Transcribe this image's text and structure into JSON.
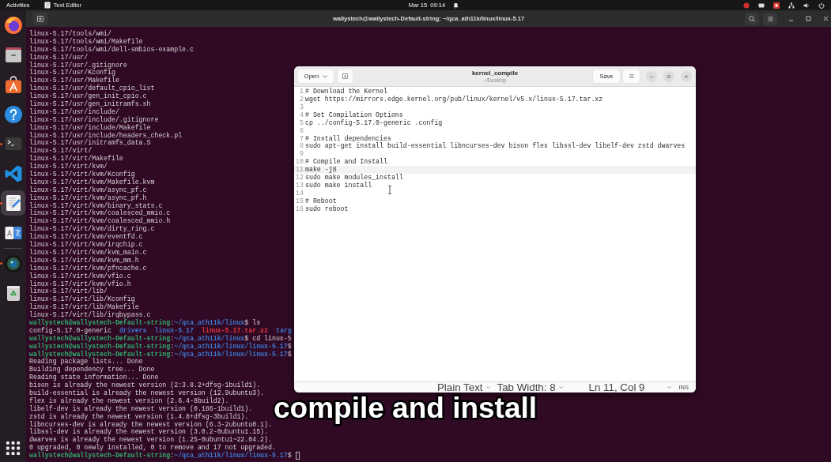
{
  "top_bar": {
    "activities": "Activities",
    "app_menu": "Text Editor",
    "clock": "Mar 15  09:14"
  },
  "dock": {
    "favorites": [
      {
        "kind": "browser",
        "running": false,
        "selected": false
      },
      {
        "kind": "files",
        "running": false,
        "selected": false
      },
      {
        "kind": "store",
        "running": false,
        "selected": false
      },
      {
        "kind": "help",
        "running": false,
        "selected": false
      },
      {
        "kind": "terminal",
        "running": true,
        "selected": false
      },
      {
        "kind": "code",
        "running": false,
        "selected": false
      },
      {
        "kind": "text_editor",
        "running": true,
        "selected": true
      },
      {
        "kind": "translator",
        "running": false,
        "selected": false
      }
    ],
    "others": [
      {
        "kind": "webcam",
        "running": true,
        "selected": false
      },
      {
        "kind": "trash",
        "running": false,
        "selected": false
      }
    ]
  },
  "terminal": {
    "title": "wallystech@wallystech-Default-string: ~/qca_ath11k/linux/linux-5.17",
    "cursor": true,
    "lines": [
      {
        "text": "linux-5.17/tools/wmi/"
      },
      {
        "text": "linux-5.17/tools/wmi/Makefile"
      },
      {
        "text": "linux-5.17/tools/wmi/dell-smbios-example.c"
      },
      {
        "text": "linux-5.17/usr/"
      },
      {
        "text": "linux-5.17/usr/.gitignore"
      },
      {
        "text": "linux-5.17/usr/Kconfig"
      },
      {
        "text": "linux-5.17/usr/Makefile"
      },
      {
        "text": "linux-5.17/usr/default_cpio_list"
      },
      {
        "text": "linux-5.17/usr/gen_init_cpio.c"
      },
      {
        "text": "linux-5.17/usr/gen_initramfs.sh"
      },
      {
        "text": "linux-5.17/usr/include/"
      },
      {
        "text": "linux-5.17/usr/include/.gitignore"
      },
      {
        "text": "linux-5.17/usr/include/Makefile"
      },
      {
        "text": "linux-5.17/usr/include/headers_check.pl"
      },
      {
        "text": "linux-5.17/usr/initramfs_data.S"
      },
      {
        "text": "linux-5.17/virt/"
      },
      {
        "text": "linux-5.17/virt/Makefile"
      },
      {
        "text": "linux-5.17/virt/kvm/"
      },
      {
        "text": "linux-5.17/virt/kvm/Kconfig"
      },
      {
        "text": "linux-5.17/virt/kvm/Makefile.kvm"
      },
      {
        "text": "linux-5.17/virt/kvm/async_pf.c"
      },
      {
        "text": "linux-5.17/virt/kvm/async_pf.h"
      },
      {
        "text": "linux-5.17/virt/kvm/binary_stats.c"
      },
      {
        "text": "linux-5.17/virt/kvm/coalesced_mmio.c"
      },
      {
        "text": "linux-5.17/virt/kvm/coalesced_mmio.h"
      },
      {
        "text": "linux-5.17/virt/kvm/dirty_ring.c"
      },
      {
        "text": "linux-5.17/virt/kvm/eventfd.c"
      },
      {
        "text": "linux-5.17/virt/kvm/irqchip.c"
      },
      {
        "text": "linux-5.17/virt/kvm/kvm_main.c"
      },
      {
        "text": "linux-5.17/virt/kvm/kvm_mm.h"
      },
      {
        "text": "linux-5.17/virt/kvm/pfncache.c"
      },
      {
        "text": "linux-5.17/virt/kvm/vfio.c"
      },
      {
        "text": "linux-5.17/virt/kvm/vfio.h"
      },
      {
        "text": "linux-5.17/virt/lib/"
      },
      {
        "text": "linux-5.17/virt/lib/Kconfig"
      },
      {
        "text": "linux-5.17/virt/lib/Makefile"
      },
      {
        "text": "linux-5.17/virt/lib/irqbypass.c"
      },
      {
        "segments": [
          {
            "kind": "user",
            "text": "wallystech@wallystech-Default-string"
          },
          {
            "kind": "plain",
            "text": ":"
          },
          {
            "kind": "path",
            "text": "~/qca_ath11k/linux"
          },
          {
            "kind": "plain",
            "text": "$ ls"
          }
        ]
      },
      {
        "segments": [
          {
            "kind": "plain",
            "text": "config-5.17.0-generic  "
          },
          {
            "kind": "directory",
            "text": "drivers  "
          },
          {
            "kind": "directory",
            "text": "linux-5.17  "
          },
          {
            "kind": "archive",
            "text": "linux-5.17.tar.xz  "
          },
          {
            "kind": "directory",
            "text": "targ"
          }
        ]
      },
      {
        "segments": [
          {
            "kind": "user",
            "text": "wallystech@wallystech-Default-string"
          },
          {
            "kind": "plain",
            "text": ":"
          },
          {
            "kind": "path",
            "text": "~/qca_ath11k/linux"
          },
          {
            "kind": "plain",
            "text": "$ cd linux-5"
          }
        ]
      },
      {
        "segments": [
          {
            "kind": "user",
            "text": "wallystech@wallystech-Default-string"
          },
          {
            "kind": "plain",
            "text": ":"
          },
          {
            "kind": "path",
            "text": "~/qca_ath11k/linux/linux-5.17"
          },
          {
            "kind": "plain",
            "text": "$"
          }
        ]
      },
      {
        "segments": [
          {
            "kind": "user",
            "text": "wallystech@wallystech-Default-string"
          },
          {
            "kind": "plain",
            "text": ":"
          },
          {
            "kind": "path",
            "text": "~/qca_ath11k/linux/linux-5.17"
          },
          {
            "kind": "plain",
            "text": "$"
          }
        ]
      },
      {
        "text": "Reading package lists... Done"
      },
      {
        "text": "Building dependency tree... Done"
      },
      {
        "text": "Reading state information... Done"
      },
      {
        "text": "bison is already the newest version (2:3.8.2+dfsg-1build1)."
      },
      {
        "text": "build-essential is already the newest version (12.9ubuntu3)."
      },
      {
        "text": "flex is already the newest version (2.6.4-8build2)."
      },
      {
        "text": "libelf-dev is already the newest version (0.186-1build1)."
      },
      {
        "text": "zstd is already the newest version (1.4.8+dfsg-3build1)."
      },
      {
        "text": "libncurses-dev is already the newest version (6.3-2ubuntu0.1)."
      },
      {
        "text": "libssl-dev is already the newest version (3.0.2-0ubuntu1.15)."
      },
      {
        "text": "dwarves is already the newest version (1.25-0ubuntu1~22.04.2)."
      },
      {
        "text": "0 upgraded, 0 newly installed, 0 to remove and 17 not upgraded."
      },
      {
        "segments": [
          {
            "kind": "user",
            "text": "wallystech@wallystech-Default-string"
          },
          {
            "kind": "plain",
            "text": ":"
          },
          {
            "kind": "path",
            "text": "~/qca_ath11k/linux/linux-5.17"
          },
          {
            "kind": "plain",
            "text": "$"
          }
        ]
      }
    ]
  },
  "editor": {
    "title": "kernel_compile",
    "subtitle": "~/Desktop",
    "open_button": "Open",
    "save_button": "Save",
    "lines": [
      {
        "number": "1",
        "text": "# Download the Kernel",
        "current": false
      },
      {
        "number": "2",
        "text": "wget https://mirrors.edge.kernel.org/pub/linux/kernel/v5.x/linux-5.17.tar.xz",
        "current": false
      },
      {
        "number": "3",
        "current": false
      },
      {
        "number": "4",
        "text": "# Set Compilation Options",
        "current": false
      },
      {
        "number": "5",
        "text": "cp ../config-5.17.0-generic .config",
        "current": false
      },
      {
        "number": "6",
        "current": false
      },
      {
        "number": "7",
        "text": "# Install dependencies",
        "current": false
      },
      {
        "number": "8",
        "text": "sudo apt-get install build-essential libncurses-dev bison flex libssl-dev libelf-dev zstd dwarves",
        "current": false
      },
      {
        "number": "9",
        "current": false
      },
      {
        "number": "10",
        "text": "# Compile and Install",
        "current": false
      },
      {
        "number": "11",
        "text": "make -j8",
        "current": true
      },
      {
        "number": "12",
        "text": "sudo make modules_install",
        "current": false
      },
      {
        "number": "13",
        "text": "sudo make install",
        "current": false
      },
      {
        "number": "14",
        "current": false
      },
      {
        "number": "15",
        "text": "# Reboot",
        "current": false
      },
      {
        "number": "16",
        "text": "sudo reboot",
        "current": false
      }
    ],
    "status_bar": {
      "language": "Plain Text",
      "tab_width": "Tab Width: 8",
      "position": "Ln 11, Col 9",
      "input_mode": "INS"
    }
  },
  "caption": "compile and install"
}
